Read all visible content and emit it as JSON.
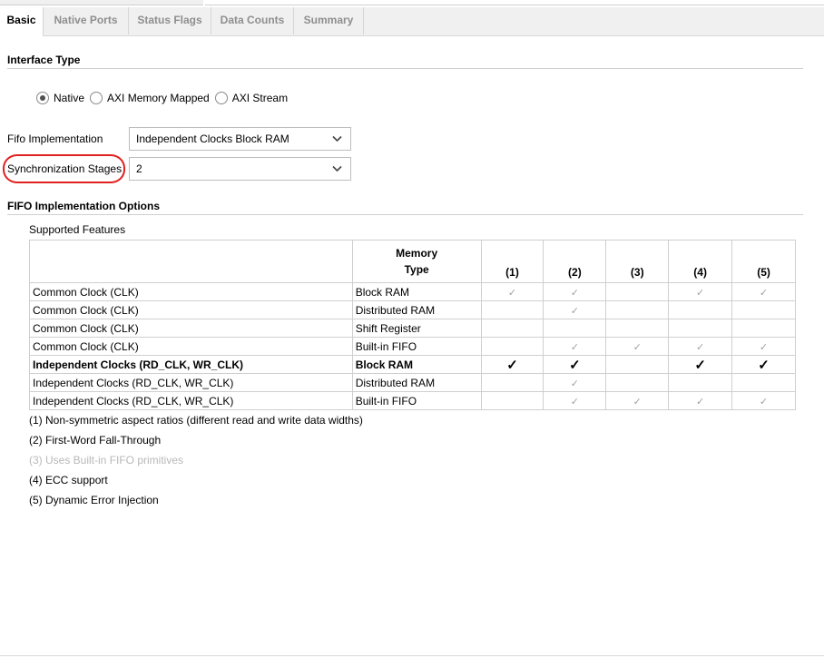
{
  "tabs": [
    {
      "label": "Basic",
      "active": true
    },
    {
      "label": "Native Ports",
      "active": false
    },
    {
      "label": "Status Flags",
      "active": false
    },
    {
      "label": "Data Counts",
      "active": false
    },
    {
      "label": "Summary",
      "active": false
    }
  ],
  "interface_type": {
    "title": "Interface Type",
    "options": [
      "Native",
      "AXI Memory Mapped",
      "AXI Stream"
    ],
    "selected": "Native"
  },
  "fifo_implementation": {
    "label": "Fifo Implementation",
    "value": "Independent Clocks Block RAM"
  },
  "sync_stages": {
    "label": "Synchronization Stages",
    "value": "2"
  },
  "options_section": {
    "title": "FIFO Implementation Options",
    "supported_features": "Supported Features",
    "table": {
      "headers": [
        "",
        "Memory",
        "Type",
        "(1)",
        "(2)",
        "(3)",
        "(4)",
        "(5)"
      ],
      "rows": [
        {
          "clock": "Common Clock (CLK)",
          "memory": "Block RAM",
          "checks": [
            true,
            true,
            false,
            true,
            true
          ],
          "bold": false
        },
        {
          "clock": "Common Clock (CLK)",
          "memory": "Distributed RAM",
          "checks": [
            false,
            true,
            false,
            false,
            false
          ],
          "bold": false
        },
        {
          "clock": "Common Clock (CLK)",
          "memory": "Shift Register",
          "checks": [
            false,
            false,
            false,
            false,
            false
          ],
          "bold": false
        },
        {
          "clock": "Common Clock (CLK)",
          "memory": "Built-in FIFO",
          "checks": [
            false,
            true,
            true,
            true,
            true
          ],
          "bold": false
        },
        {
          "clock": "Independent Clocks (RD_CLK, WR_CLK)",
          "memory": "Block RAM",
          "checks": [
            true,
            true,
            false,
            true,
            true
          ],
          "bold": true
        },
        {
          "clock": "Independent Clocks (RD_CLK, WR_CLK)",
          "memory": "Distributed RAM",
          "checks": [
            false,
            true,
            false,
            false,
            false
          ],
          "bold": false
        },
        {
          "clock": "Independent Clocks (RD_CLK, WR_CLK)",
          "memory": "Built-in FIFO",
          "checks": [
            false,
            true,
            true,
            true,
            true
          ],
          "bold": false
        }
      ]
    },
    "notes": [
      {
        "text": "(1) Non-symmetric aspect ratios (different read and write data widths)",
        "dim": false
      },
      {
        "text": "(2) First-Word Fall-Through",
        "dim": false
      },
      {
        "text": "(3) Uses Built-in FIFO primitives",
        "dim": true
      },
      {
        "text": "(4) ECC support",
        "dim": false
      },
      {
        "text": "(5) Dynamic Error Injection",
        "dim": false
      }
    ]
  },
  "icons": {
    "dropdown": "chevron-down-icon",
    "check": "check-icon",
    "radio": "radio-icon"
  },
  "colors": {
    "highlight_ring": "#e02020",
    "tab_bar": "#f0f0f0",
    "disabled_text": "#b8b8b8"
  }
}
